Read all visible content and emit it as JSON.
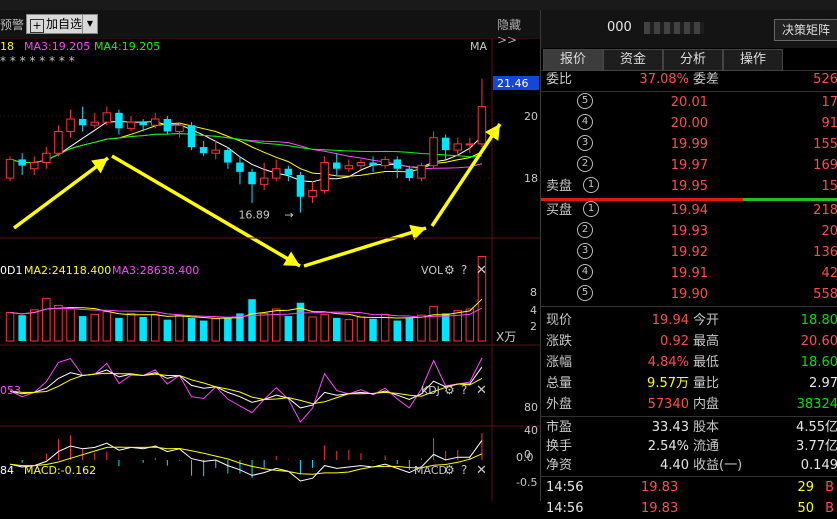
{
  "toolbar": {
    "alert_label": "预警",
    "add_fav_label": "加自选",
    "hide_label": "隐藏>>"
  },
  "main_chart": {
    "ma_labels": [
      {
        "text": "18",
        "color": "#ffff00"
      },
      {
        "text": "MA3:19.205",
        "color": "#ff44ff"
      },
      {
        "text": "MA4:19.205",
        "color": "#00ff00"
      }
    ],
    "ma_right": "MA",
    "price_ticks": [
      "20",
      "18"
    ],
    "current_price_tag": "21.46",
    "low_label": "16.89",
    "stars_row": "*  * *      * * *   * *"
  },
  "vol_panel": {
    "labels": [
      {
        "text": "0D1",
        "color": "#ffffff"
      },
      {
        "text": "MA2:24118.400",
        "color": "#ffff00"
      },
      {
        "text": "MA3:28638.400",
        "color": "#ff44ff"
      }
    ],
    "name": "VOL",
    "ticks": [
      "8",
      "4",
      "2"
    ],
    "unit": "X万"
  },
  "kdj_panel": {
    "labels": [
      {
        "text": "053",
        "color": "#ff44ff"
      }
    ],
    "name": "KDJ",
    "ticks": [
      "80",
      "40",
      "0"
    ]
  },
  "macd_panel": {
    "labels": [
      {
        "text": "84",
        "color": "#ffffff"
      },
      {
        "text": "MACD:-0.162",
        "color": "#ffff00"
      }
    ],
    "name": "MACD",
    "ticks": [
      "0.0",
      "-0.5"
    ]
  },
  "right_panel": {
    "stock_code": "000",
    "decision_button": "决策矩阵",
    "tabs": [
      "报价",
      "资金",
      "分析",
      "操作"
    ],
    "weibi": {
      "label": "委比",
      "value": "37.08%",
      "label2": "委差",
      "value2": "526"
    },
    "asks": [
      {
        "level": "⑤",
        "price": "20.01",
        "vol": "17"
      },
      {
        "level": "④",
        "price": "20.00",
        "vol": "91"
      },
      {
        "level": "③",
        "price": "19.99",
        "vol": "155"
      },
      {
        "level": "②",
        "price": "19.97",
        "vol": "169"
      },
      {
        "level": "卖盘①",
        "price": "19.95",
        "vol": "15"
      }
    ],
    "bids": [
      {
        "level": "买盘①",
        "price": "19.94",
        "vol": "218"
      },
      {
        "level": "②",
        "price": "19.93",
        "vol": "20"
      },
      {
        "level": "③",
        "price": "19.92",
        "vol": "136"
      },
      {
        "level": "④",
        "price": "19.91",
        "vol": "42"
      },
      {
        "level": "⑤",
        "price": "19.90",
        "vol": "558"
      }
    ],
    "quote": [
      {
        "l1": "现价",
        "v1": "19.94",
        "c1": "red",
        "l2": "今开",
        "v2": "18.80",
        "c2": "green"
      },
      {
        "l1": "涨跌",
        "v1": "0.92",
        "c1": "red",
        "l2": "最高",
        "v2": "20.60",
        "c2": "red"
      },
      {
        "l1": "涨幅",
        "v1": "4.84%",
        "c1": "red",
        "l2": "最低",
        "v2": "18.60",
        "c2": "green"
      },
      {
        "l1": "总量",
        "v1": "9.57万",
        "c1": "yellow",
        "l2": "量比",
        "v2": "2.97",
        "c2": "white"
      },
      {
        "l1": "外盘",
        "v1": "57340",
        "c1": "red",
        "l2": "内盘",
        "v2": "38324",
        "c2": "green"
      }
    ],
    "fundamentals": [
      {
        "l1": "市盈",
        "v1": "33.43",
        "l2": "股本",
        "v2": "4.55亿"
      },
      {
        "l1": "换手",
        "v1": "2.54%",
        "l2": "流通",
        "v2": "3.77亿"
      },
      {
        "l1": "净资",
        "v1": "4.40",
        "l2": "收益(一)",
        "v2": "0.149"
      }
    ],
    "ticks_trades": [
      {
        "time": "14:56",
        "price": "19.83",
        "vol": "29",
        "side": "B"
      },
      {
        "time": "14:56",
        "price": "19.83",
        "vol": "50",
        "side": "B"
      }
    ]
  },
  "candles": [
    {
      "o": 18.0,
      "c": 18.6,
      "h": 18.7,
      "l": 17.9
    },
    {
      "o": 18.6,
      "c": 18.4,
      "h": 18.8,
      "l": 18.1
    },
    {
      "o": 18.3,
      "c": 18.5,
      "h": 18.7,
      "l": 18.1
    },
    {
      "o": 18.5,
      "c": 18.8,
      "h": 19.0,
      "l": 18.3
    },
    {
      "o": 18.8,
      "c": 19.5,
      "h": 19.7,
      "l": 18.7
    },
    {
      "o": 19.5,
      "c": 19.9,
      "h": 20.2,
      "l": 19.3
    },
    {
      "o": 19.9,
      "c": 19.7,
      "h": 20.3,
      "l": 19.5
    },
    {
      "o": 19.7,
      "c": 19.8,
      "h": 20.1,
      "l": 19.6
    },
    {
      "o": 19.8,
      "c": 20.1,
      "h": 20.3,
      "l": 19.7
    },
    {
      "o": 20.1,
      "c": 19.6,
      "h": 20.2,
      "l": 19.4
    },
    {
      "o": 19.6,
      "c": 19.8,
      "h": 20.0,
      "l": 19.5
    },
    {
      "o": 19.8,
      "c": 19.7,
      "h": 19.9,
      "l": 19.5
    },
    {
      "o": 19.7,
      "c": 19.9,
      "h": 20.1,
      "l": 19.6
    },
    {
      "o": 19.9,
      "c": 19.5,
      "h": 20.0,
      "l": 19.4
    },
    {
      "o": 19.5,
      "c": 19.7,
      "h": 19.8,
      "l": 19.3
    },
    {
      "o": 19.7,
      "c": 19.0,
      "h": 19.8,
      "l": 18.9
    },
    {
      "o": 19.0,
      "c": 18.8,
      "h": 19.2,
      "l": 18.7
    },
    {
      "o": 18.8,
      "c": 18.9,
      "h": 19.2,
      "l": 18.6
    },
    {
      "o": 18.9,
      "c": 18.5,
      "h": 19.0,
      "l": 18.3
    },
    {
      "o": 18.5,
      "c": 18.2,
      "h": 18.7,
      "l": 17.8
    },
    {
      "o": 18.2,
      "c": 17.8,
      "h": 18.3,
      "l": 17.2
    },
    {
      "o": 17.8,
      "c": 18.0,
      "h": 18.5,
      "l": 17.6
    },
    {
      "o": 18.0,
      "c": 18.3,
      "h": 18.6,
      "l": 17.9
    },
    {
      "o": 18.3,
      "c": 18.1,
      "h": 18.4,
      "l": 17.9
    },
    {
      "o": 18.1,
      "c": 17.4,
      "h": 18.2,
      "l": 16.89
    },
    {
      "o": 17.4,
      "c": 17.6,
      "h": 17.9,
      "l": 17.2
    },
    {
      "o": 17.6,
      "c": 18.5,
      "h": 18.7,
      "l": 17.5
    },
    {
      "o": 18.5,
      "c": 18.3,
      "h": 18.8,
      "l": 18.1
    },
    {
      "o": 18.3,
      "c": 18.4,
      "h": 18.6,
      "l": 18.2
    },
    {
      "o": 18.4,
      "c": 18.5,
      "h": 18.6,
      "l": 18.3
    },
    {
      "o": 18.5,
      "c": 18.4,
      "h": 18.7,
      "l": 18.2
    },
    {
      "o": 18.4,
      "c": 18.6,
      "h": 18.7,
      "l": 18.3
    },
    {
      "o": 18.6,
      "c": 18.3,
      "h": 18.7,
      "l": 18.0
    },
    {
      "o": 18.3,
      "c": 18.0,
      "h": 18.4,
      "l": 17.9
    },
    {
      "o": 18.0,
      "c": 18.4,
      "h": 18.5,
      "l": 17.9
    },
    {
      "o": 18.4,
      "c": 19.3,
      "h": 19.5,
      "l": 18.3
    },
    {
      "o": 19.3,
      "c": 18.9,
      "h": 19.4,
      "l": 18.6
    },
    {
      "o": 18.9,
      "c": 19.1,
      "h": 19.3,
      "l": 18.7
    },
    {
      "o": 19.1,
      "c": 19.1,
      "h": 19.3,
      "l": 18.8
    },
    {
      "o": 19.1,
      "c": 20.3,
      "h": 21.2,
      "l": 19.0
    }
  ],
  "volumes": [
    3.2,
    2.9,
    3.5,
    4.8,
    4.0,
    3.6,
    2.8,
    3.0,
    3.3,
    2.6,
    3.1,
    2.7,
    3.0,
    2.4,
    2.9,
    2.6,
    2.3,
    2.5,
    2.6,
    3.1,
    4.7,
    3.1,
    3.6,
    2.8,
    4.3,
    2.7,
    3.0,
    2.6,
    2.4,
    2.7,
    2.5,
    3.0,
    2.3,
    2.6,
    2.9,
    3.9,
    3.1,
    3.4,
    3.6,
    9.5
  ],
  "colors": {
    "up": "#ff3333",
    "down": "#00e5ff",
    "ma1": "#ffffff",
    "ma2": "#ffff00",
    "ma3": "#ff44ff",
    "ma4": "#00ff00",
    "arrow": "#ffff00"
  }
}
